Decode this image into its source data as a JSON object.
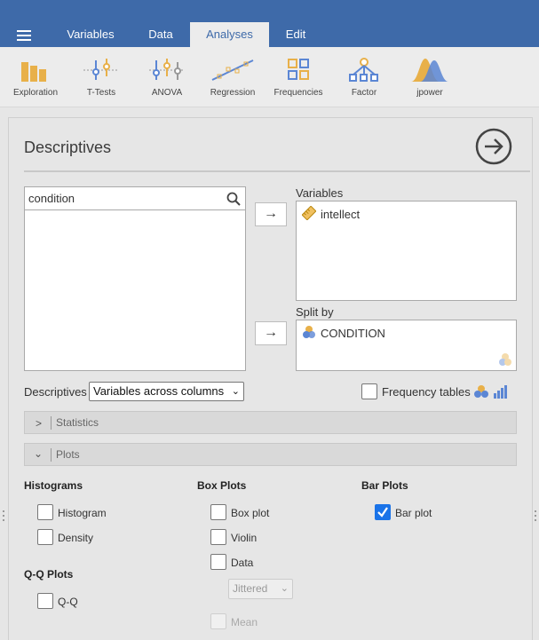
{
  "menu_tabs": [
    "Variables",
    "Data",
    "Analyses",
    "Edit"
  ],
  "ribbon": [
    {
      "label": "Exploration",
      "icon": "exploration-icon"
    },
    {
      "label": "T-Tests",
      "icon": "ttests-icon"
    },
    {
      "label": "ANOVA",
      "icon": "anova-icon"
    },
    {
      "label": "Regression",
      "icon": "regression-icon"
    },
    {
      "label": "Frequencies",
      "icon": "frequencies-icon"
    },
    {
      "label": "Factor",
      "icon": "factor-icon"
    },
    {
      "label": "jpower",
      "icon": "jpower-icon"
    }
  ],
  "analysis": {
    "title": "Descriptives",
    "search_value": "condition",
    "variables_label": "Variables",
    "variables": [
      "intellect"
    ],
    "splitby_label": "Split by",
    "splitby": [
      "CONDITION"
    ]
  },
  "options": {
    "descriptives_label": "Descriptives",
    "descriptives_select": "Variables across columns",
    "frequency_tables": "Frequency tables",
    "frequency_tables_checked": false
  },
  "sections": {
    "statistics": "Statistics",
    "plots": "Plots"
  },
  "plots": {
    "histograms_heading": "Histograms",
    "histogram": "Histogram",
    "density": "Density",
    "qq_heading": "Q-Q Plots",
    "qq": "Q-Q",
    "boxplots_heading": "Box Plots",
    "boxplot": "Box plot",
    "violin": "Violin",
    "data": "Data",
    "data_type": "Jittered",
    "mean": "Mean",
    "barplots_heading": "Bar Plots",
    "barplot": "Bar plot",
    "barplot_checked": true
  },
  "colors": {
    "topbar": "#3e6aa9",
    "accent_blue": "#1a73e8",
    "icon_orange": "#e8b049",
    "icon_blue": "#5b86d4"
  }
}
